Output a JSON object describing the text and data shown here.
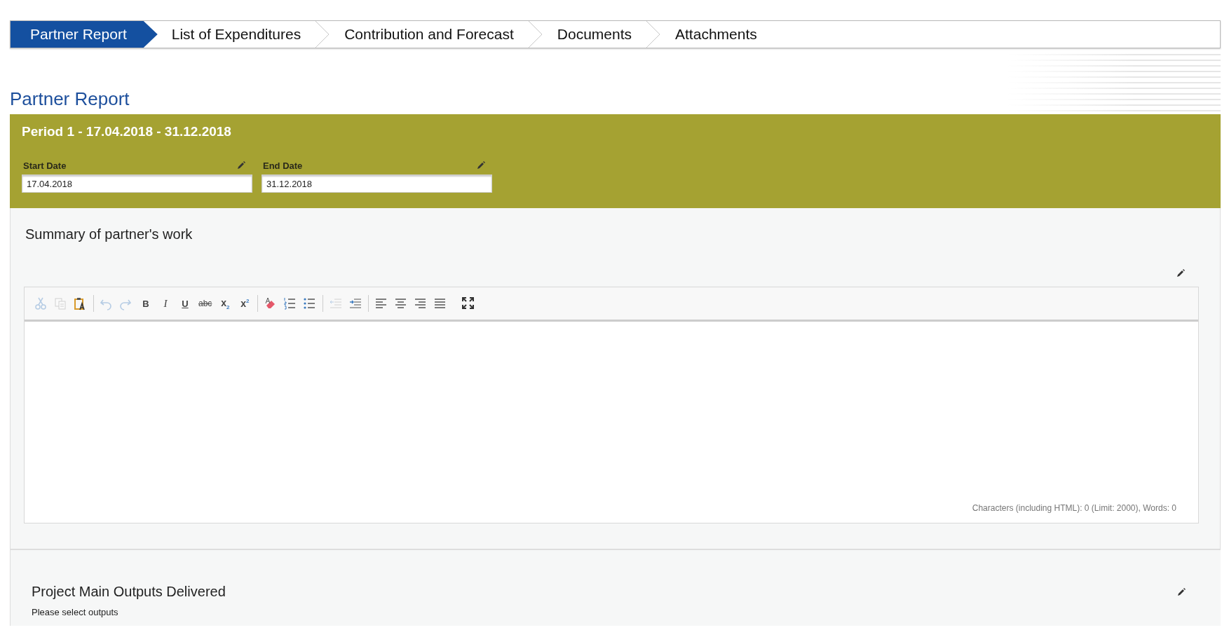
{
  "tabs": [
    {
      "label": "Partner Report",
      "selected": true
    },
    {
      "label": "List of Expenditures",
      "selected": false
    },
    {
      "label": "Contribution and Forecast",
      "selected": false
    },
    {
      "label": "Documents",
      "selected": false
    },
    {
      "label": "Attachments",
      "selected": false
    }
  ],
  "page_title": "Partner Report",
  "period": {
    "title": "Period 1 - 17.04.2018 - 31.12.2018",
    "fields": [
      {
        "label": "Start Date",
        "value": "17.04.2018"
      },
      {
        "label": "End Date",
        "value": "31.12.2018"
      }
    ]
  },
  "summary": {
    "title": "Summary of partner's work",
    "toolbar": [
      [
        {
          "kind": "cut",
          "disabled": true
        },
        {
          "kind": "copy",
          "disabled": true
        },
        {
          "kind": "paste-text",
          "disabled": false
        }
      ],
      [
        {
          "kind": "undo",
          "disabled": true
        },
        {
          "kind": "redo",
          "disabled": true
        },
        {
          "kind": "bold",
          "label": "B",
          "disabled": false
        },
        {
          "kind": "italic",
          "label": "I",
          "disabled": false
        },
        {
          "kind": "underline",
          "label": "U",
          "disabled": false
        },
        {
          "kind": "strike",
          "label": "abc",
          "disabled": false
        },
        {
          "kind": "subscript",
          "label": "x$_{2}$",
          "disabled": false
        },
        {
          "kind": "superscript",
          "label": "x$^{2}$",
          "disabled": false
        }
      ],
      [
        {
          "kind": "eraser",
          "disabled": false
        },
        {
          "kind": "numbered-list",
          "disabled": false
        },
        {
          "kind": "bullet-list",
          "disabled": false
        }
      ],
      [
        {
          "kind": "outdent",
          "disabled": true
        },
        {
          "kind": "indent",
          "disabled": false
        }
      ],
      [
        {
          "kind": "align-left",
          "disabled": false
        },
        {
          "kind": "align-center",
          "disabled": false
        },
        {
          "kind": "align-right",
          "disabled": false
        },
        {
          "kind": "justify",
          "disabled": false
        },
        {
          "kind": "maximize",
          "disabled": false
        }
      ]
    ],
    "counter": "Characters (including HTML): 0 (Limit: 2000), Words: 0"
  },
  "outputs": {
    "title": "Project Main Outputs Delivered",
    "hint": "Please select outputs"
  }
}
